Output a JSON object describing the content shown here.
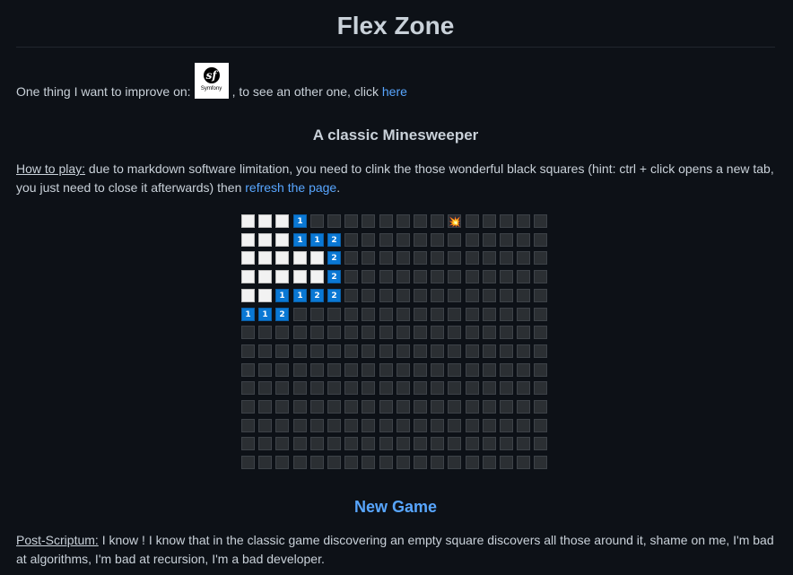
{
  "header": {
    "title": "Flex Zone"
  },
  "intro": {
    "text_before": "One thing I want to improve on:",
    "logo_text": "Symfony",
    "logo_icon": "symfony-logo",
    "text_after": ", to see an other one, click",
    "link_label": "here"
  },
  "game": {
    "title": "A classic Minesweeper",
    "howto_label": "How to play:",
    "howto_text": " due to markdown software limitation, you need to clink the those wonderful black squares (hint: ctrl + click opens a new tab, you just need to close it afterwards) then ",
    "refresh_link": "refresh the page",
    "howto_end": ".",
    "board": {
      "rows": [
        "...1........*...",
        "...112..........",
        ".....2..........",
        ".....2..........",
        "..1122..........",
        "112.............",
        "................",
        "................",
        "................",
        "................",
        "................",
        "................",
        "................",
        "................"
      ],
      "revealed_mask": [
        "RRRR............",
        "RRRRRR..........",
        "RRRRRR..........",
        "RRRRRR..........",
        "RRRRRR..........",
        "RRR.............",
        "................",
        "................",
        "................",
        "................",
        "................",
        "................",
        "................",
        "................"
      ],
      "mine_glyph": "💥",
      "colors": {
        "hidden": "#2b2f33",
        "empty": "#f2f2f2",
        "number": "#0a78d4"
      }
    },
    "new_game_label": "New Game"
  },
  "postscript": {
    "label": "Post-Scriptum:",
    "text": " I know ! I know that in the classic game discovering an empty square discovers all those around it, shame on me, I'm bad at algorithms, I'm bad at recursion, I'm a bad developer."
  }
}
